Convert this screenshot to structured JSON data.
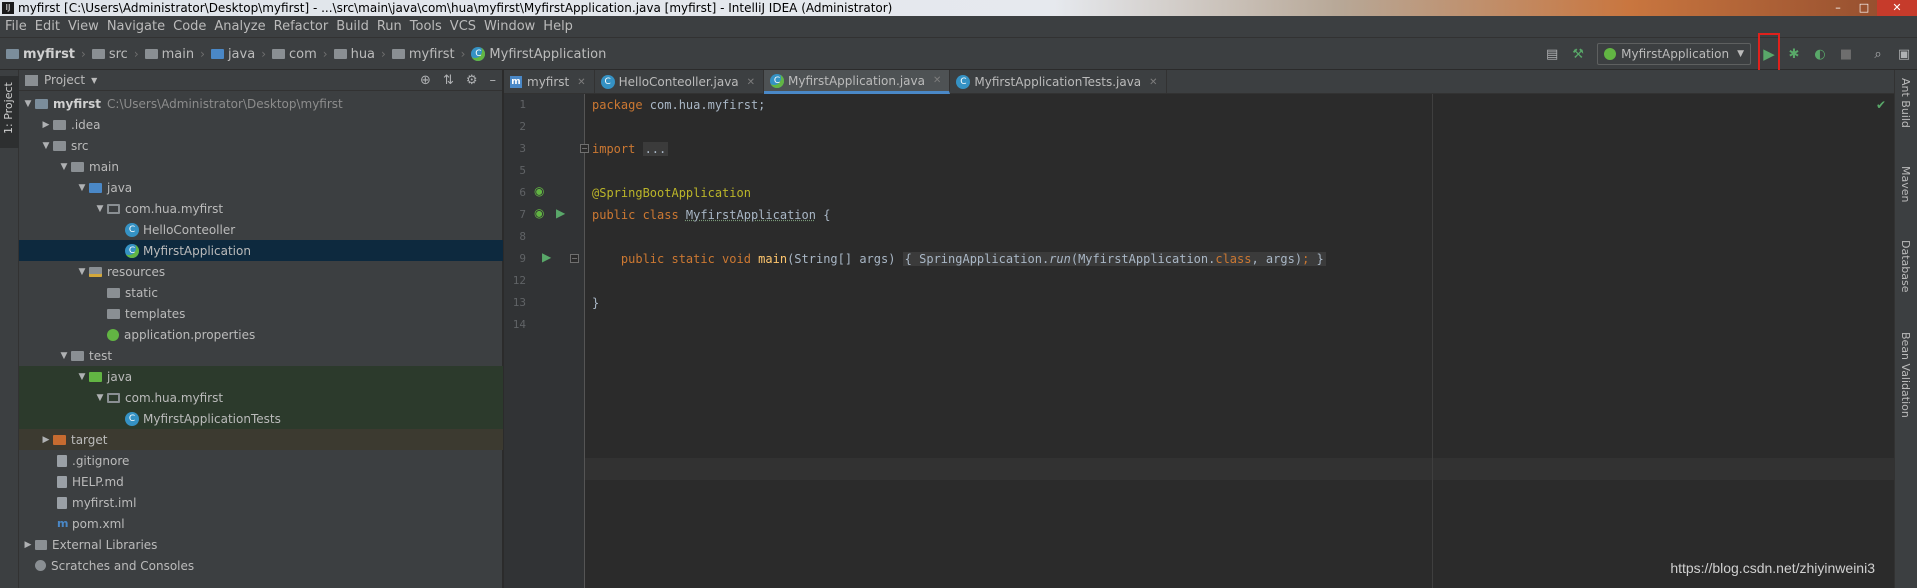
{
  "window": {
    "title": "myfirst [C:\\Users\\Administrator\\Desktop\\myfirst] - ...\\src\\main\\java\\com\\hua\\myfirst\\MyfirstApplication.java [myfirst] - IntelliJ IDEA (Administrator)",
    "app_icon_glyph": "IJ",
    "minimize_glyph": "–",
    "maximize_glyph": "□",
    "close_glyph": "✕"
  },
  "menu": [
    "File",
    "Edit",
    "View",
    "Navigate",
    "Code",
    "Analyze",
    "Refactor",
    "Build",
    "Run",
    "Tools",
    "VCS",
    "Window",
    "Help"
  ],
  "breadcrumb": [
    "myfirst",
    "src",
    "main",
    "java",
    "com",
    "hua",
    "myfirst",
    "MyfirstApplication"
  ],
  "toolbar": {
    "run_config": "MyfirstApplication",
    "run_glyph": "▶",
    "debug_glyph": "✱",
    "coverage_glyph": "◐",
    "stop_glyph": "■",
    "search_glyph": "⌕",
    "structure_glyph": "▣",
    "build_glyph": "⚒",
    "layout_glyph": "▤"
  },
  "left_strip": {
    "project_tab": "1: Project"
  },
  "project_panel": {
    "title": "Project",
    "dropdown_glyph": "▼",
    "locate_glyph": "⊕",
    "collapse_glyph": "⇅",
    "settings_glyph": "⚙",
    "hide_glyph": "–",
    "tree": [
      {
        "label": "myfirst",
        "path": "C:\\Users\\Administrator\\Desktop\\myfirst",
        "arrow": "▼"
      },
      {
        "label": ".idea",
        "arrow": "▶"
      },
      {
        "label": "src",
        "arrow": "▼"
      },
      {
        "label": "main",
        "arrow": "▼"
      },
      {
        "label": "java",
        "arrow": "▼"
      },
      {
        "label": "com.hua.myfirst",
        "arrow": "▼"
      },
      {
        "label": "HelloConteoller",
        "icon": "C"
      },
      {
        "label": "MyfirstApplication",
        "icon": "C"
      },
      {
        "label": "resources",
        "arrow": "▼"
      },
      {
        "label": "static"
      },
      {
        "label": "templates"
      },
      {
        "label": "application.properties"
      },
      {
        "label": "test",
        "arrow": "▼"
      },
      {
        "label": "java",
        "arrow": "▼"
      },
      {
        "label": "com.hua.myfirst",
        "arrow": "▼"
      },
      {
        "label": "MyfirstApplicationTests",
        "icon": "C"
      },
      {
        "label": "target",
        "arrow": "▶"
      },
      {
        "label": ".gitignore"
      },
      {
        "label": "HELP.md"
      },
      {
        "label": "myfirst.iml"
      },
      {
        "label": "pom.xml",
        "icon": "m"
      },
      {
        "label": "External Libraries",
        "arrow": "▶"
      },
      {
        "label": "Scratches and Consoles"
      }
    ]
  },
  "editor_tabs": [
    {
      "label": "myfirst",
      "icon": "m",
      "close": "✕"
    },
    {
      "label": "HelloConteoller.java",
      "icon": "C",
      "close": "✕"
    },
    {
      "label": "MyfirstApplication.java",
      "icon": "C",
      "close": "✕",
      "active": true
    },
    {
      "label": "MyfirstApplicationTests.java",
      "icon": "C",
      "close": "✕"
    }
  ],
  "editor": {
    "line_numbers": [
      "1",
      "2",
      "3",
      "5",
      "6",
      "7",
      "8",
      "9",
      "12",
      "13",
      "14"
    ],
    "code": {
      "l1_kw": "package ",
      "l1_rest": "com.hua.myfirst;",
      "l3_kw": "import ",
      "l3_fold": "...",
      "l6_ann": "@SpringBootApplication",
      "l7_kw": "public class ",
      "l7_name": "MyfirstApplication",
      "l7_rest": " {",
      "l9_kw1": "    public static void ",
      "l9_fn": "main",
      "l9_params": "(String[] args) ",
      "l9_fold_open": "{ ",
      "l9_body1": "SpringApplication.",
      "l9_run": "run",
      "l9_body2": "(MyfirstApplication.",
      "l9_class": "class",
      "l9_body3": ", args)",
      "l9_semi": ";",
      "l9_close": " }",
      "l13": "}"
    },
    "fold_glyph": "−",
    "check_glyph": "✔",
    "run_gutter_glyph": "▶",
    "bean_gutter_glyph": "◉"
  },
  "right_strip": [
    "Ant Build",
    "Maven",
    "Database",
    "Bean Validation"
  ],
  "watermark": "https://blog.csdn.net/zhiyinweini3"
}
